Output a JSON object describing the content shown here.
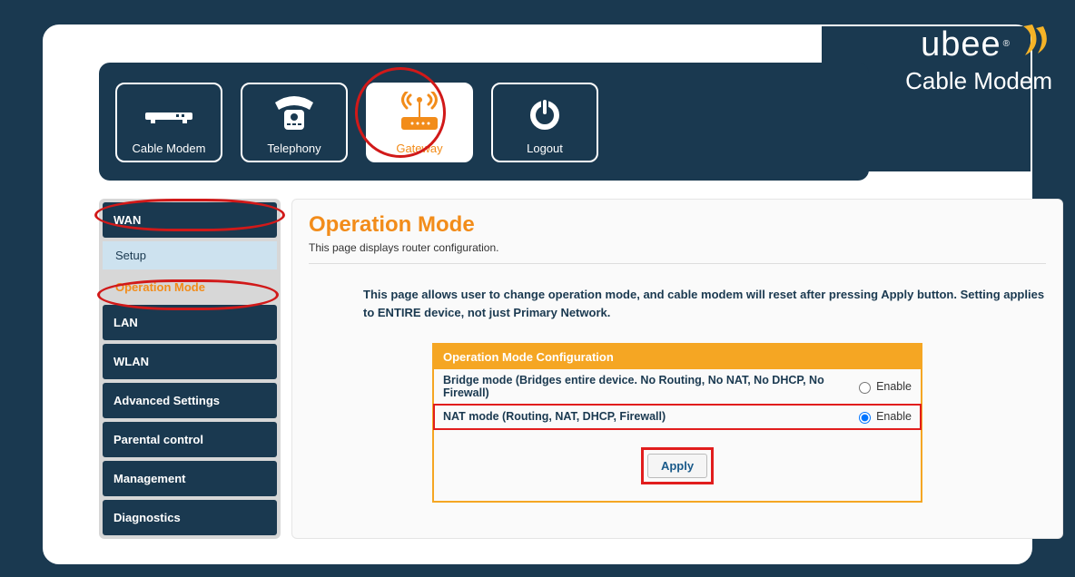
{
  "brand": {
    "name": "ubee",
    "reg": "®",
    "product": "Cable Modem"
  },
  "topnav": {
    "items": [
      {
        "label": "Cable  Modem"
      },
      {
        "label": "Telephony"
      },
      {
        "label": "Gateway"
      },
      {
        "label": "Logout"
      }
    ]
  },
  "sidebar": {
    "groups": [
      {
        "label": "WAN",
        "subs": [
          {
            "label": "Setup"
          },
          {
            "label": "Operation Mode",
            "active": true
          }
        ]
      },
      {
        "label": "LAN"
      },
      {
        "label": "WLAN"
      },
      {
        "label": "Advanced Settings"
      },
      {
        "label": "Parental control"
      },
      {
        "label": "Management"
      },
      {
        "label": "Diagnostics"
      }
    ]
  },
  "page": {
    "title": "Operation Mode",
    "desc": "This page displays router configuration.",
    "note": "This page allows user to change operation mode, and cable modem will reset after pressing Apply button. Setting applies to ENTIRE device, not just Primary Network."
  },
  "config": {
    "head": "Operation Mode Configuration",
    "rows": [
      {
        "label": "Bridge mode (Bridges entire device. No Routing, No NAT, No DHCP, No Firewall)",
        "option": "Enable",
        "checked": false
      },
      {
        "label": "NAT mode (Routing, NAT, DHCP, Firewall)",
        "option": "Enable",
        "checked": true,
        "highlight": true
      }
    ],
    "apply": "Apply"
  }
}
